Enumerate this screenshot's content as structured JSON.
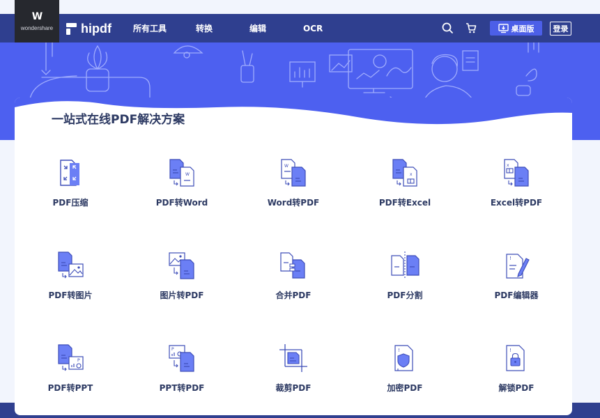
{
  "wondershare_logo": {
    "mark": "W",
    "text": "wondershare"
  },
  "brand": {
    "name": "hipdf"
  },
  "nav": [
    {
      "label": "所有工具"
    },
    {
      "label": "转换"
    },
    {
      "label": "编辑"
    },
    {
      "label": "OCR"
    }
  ],
  "header_actions": {
    "desktop_label": "桌面版",
    "login_label": "登录"
  },
  "icons": {
    "search": "search-icon",
    "cart": "cart-icon",
    "download": "download-icon"
  },
  "colors": {
    "navbar": "#2f3f8f",
    "hero": "#4d60f0",
    "accent": "#4c5fe8",
    "text": "#2d3a63"
  },
  "main": {
    "title": "一站式在线PDF解决方案",
    "tools": [
      {
        "label": "PDF压缩"
      },
      {
        "label": "PDF转Word"
      },
      {
        "label": "Word转PDF"
      },
      {
        "label": "PDF转Excel"
      },
      {
        "label": "Excel转PDF"
      },
      {
        "label": "PDF转图片"
      },
      {
        "label": "图片转PDF"
      },
      {
        "label": "合并PDF"
      },
      {
        "label": "PDF分割"
      },
      {
        "label": "PDF编辑器"
      },
      {
        "label": "PDF转PPT"
      },
      {
        "label": "PPT转PDF"
      },
      {
        "label": "裁剪PDF"
      },
      {
        "label": "加密PDF"
      },
      {
        "label": "解锁PDF"
      }
    ]
  }
}
